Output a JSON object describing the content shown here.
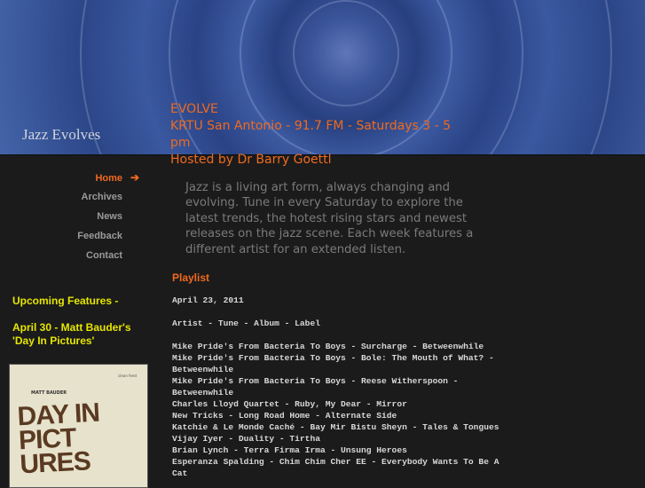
{
  "header": {
    "site_title": "Jazz Evolves",
    "show_name": "EVOLVE",
    "station": "KRTU San Antonio - 91.7 FM - Saturdays 3 - 5 pm",
    "host": "Hosted by Dr Barry Goettl"
  },
  "nav": {
    "items": [
      {
        "label": "Home",
        "active": true,
        "icon": "arrow-right-icon"
      },
      {
        "label": "Archives"
      },
      {
        "label": "News"
      },
      {
        "label": "Feedback"
      },
      {
        "label": "Contact"
      }
    ]
  },
  "intro": "Jazz is a living art form, always changing and evolving. Tune in every Saturday to explore the latest trends, the hotest rising stars and newest releases on the jazz scene. Each week features a different artist for an extended listen.",
  "sidebar": {
    "upcoming_title": "Upcoming Features -",
    "upcoming_item": "April 30 - Matt Bauder's 'Day In Pictures'",
    "album_art": {
      "artist": "MATT BAUDER",
      "title": "DAY IN PICT URES",
      "label": "clean feed"
    }
  },
  "playlist": {
    "heading": "Playlist",
    "date": "April 23, 2011",
    "columns": "Artist - Tune - Album - Label",
    "tracks": [
      "Mike Pride's From Bacteria To Boys - Surcharge - Betweenwhile",
      "Mike Pride's From Bacteria To Boys - Bole: The Mouth of What? - Betweenwhile",
      "Mike Pride's From Bacteria To Boys - Reese Witherspoon - Betweenwhile",
      "Charles Lloyd Quartet - Ruby, My Dear - Mirror",
      "New Tricks - Long Road Home - Alternate Side",
      "Katchie & Le Monde Caché - Bay Mir Bistu Sheyn - Tales & Tongues",
      "Vijay Iyer - Duality - Tirtha",
      "Brian Lynch - Terra Firma Irma - Unsung Heroes",
      "Esperanza Spalding - Chim Chim Cher EE - Everybody Wants To Be A Cat"
    ]
  }
}
